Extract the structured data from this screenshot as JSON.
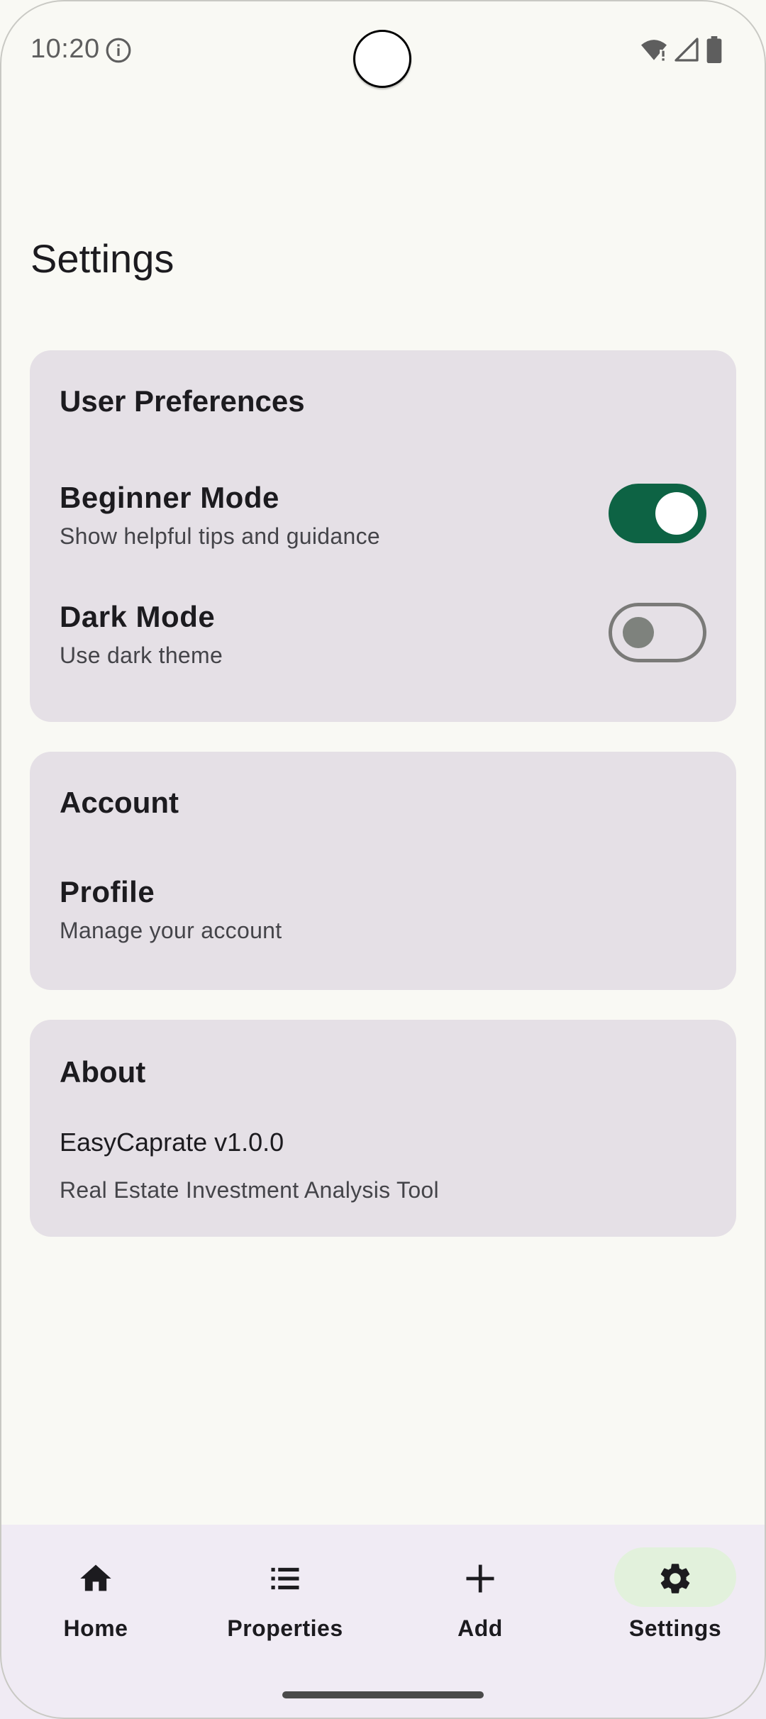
{
  "status_bar": {
    "time": "10:20",
    "icons": [
      "info-icon",
      "wifi-icon",
      "signal-icon",
      "battery-icon"
    ]
  },
  "page": {
    "title": "Settings"
  },
  "user_preferences": {
    "title": "User Preferences",
    "beginner_mode": {
      "title": "Beginner Mode",
      "subtitle": "Show helpful tips and guidance",
      "enabled": true
    },
    "dark_mode": {
      "title": "Dark Mode",
      "subtitle": "Use dark theme",
      "enabled": false
    }
  },
  "account": {
    "title": "Account",
    "profile": {
      "title": "Profile",
      "subtitle": "Manage your account"
    }
  },
  "about": {
    "title": "About",
    "version": "EasyCaprate v1.0.0",
    "description": "Real Estate Investment Analysis Tool"
  },
  "bottom_nav": {
    "items": [
      {
        "label": "Home",
        "icon": "home-icon",
        "active": false
      },
      {
        "label": "Properties",
        "icon": "list-icon",
        "active": false
      },
      {
        "label": "Add",
        "icon": "plus-icon",
        "active": false
      },
      {
        "label": "Settings",
        "icon": "gear-icon",
        "active": true
      }
    ]
  },
  "colors": {
    "background": "#f9f9f4",
    "card": "#e5e0e6",
    "switch_on": "#0d6344",
    "nav_background": "#f0ebf4",
    "nav_active_pill": "#e2f1dc"
  }
}
